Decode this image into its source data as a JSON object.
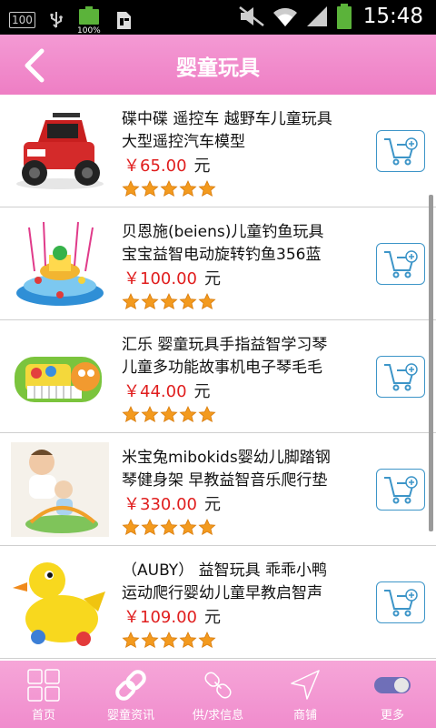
{
  "status_bar": {
    "badge": "100",
    "battery_label": "100%",
    "time": "15:48"
  },
  "header": {
    "title": "婴童玩具",
    "back_icon": "chevron-left-icon"
  },
  "products": [
    {
      "name_line1": "碟中碟 遥控车 越野车儿童玩具",
      "name_line2": "大型遥控汽车模型",
      "price": "￥65.00",
      "unit": "元",
      "rating": 5,
      "image": "rc-jeep-toy"
    },
    {
      "name_line1": "贝恩施(beiens)儿童钓鱼玩具",
      "name_line2": "宝宝益智电动旋转钓鱼356蓝",
      "price": "￥100.00",
      "unit": "元",
      "rating": 5,
      "image": "fishing-game-toy"
    },
    {
      "name_line1": "汇乐 婴童玩具手指益智学习琴",
      "name_line2": "儿童多功能故事机电子琴毛毛",
      "price": "￥44.00",
      "unit": "元",
      "rating": 5,
      "image": "caterpillar-piano-toy"
    },
    {
      "name_line1": "米宝兔mibokids婴幼儿脚踏钢",
      "name_line2": "琴健身架 早教益智音乐爬行垫",
      "price": "￥330.00",
      "unit": "元",
      "rating": 5,
      "image": "baby-play-gym-photo"
    },
    {
      "name_line1": "（AUBY） 益智玩具 乖乖小鸭",
      "name_line2": "运动爬行婴幼儿童早教启智声",
      "price": "￥109.00",
      "unit": "元",
      "rating": 5,
      "image": "yellow-duck-toy"
    }
  ],
  "bottom_nav": [
    {
      "label": "首页",
      "icon": "grid-icon"
    },
    {
      "label": "婴童资讯",
      "icon": "chain-link-icon"
    },
    {
      "label": "供/求信息",
      "icon": "chain-link-outline-icon"
    },
    {
      "label": "商铺",
      "icon": "navigation-arrow-icon"
    },
    {
      "label": "更多",
      "icon": "toggle-icon"
    }
  ],
  "colors": {
    "header_pink": "#ee7ec4",
    "price_red": "#e01e1e",
    "cart_blue": "#3d95c8",
    "star_orange": "#f39a1e"
  }
}
